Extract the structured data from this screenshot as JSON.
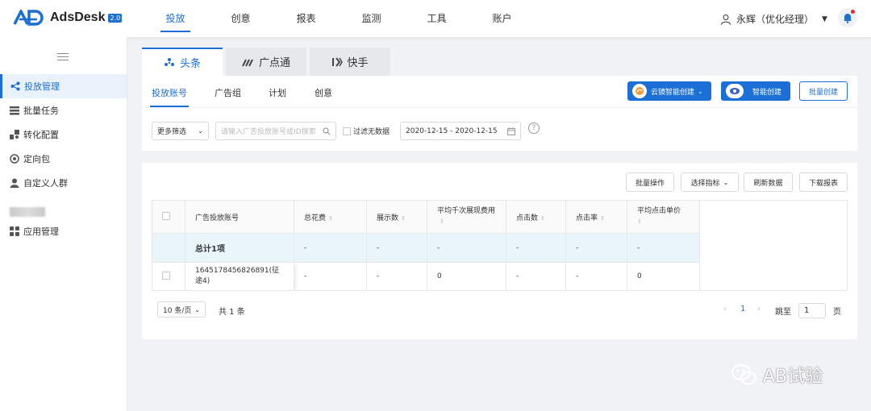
{
  "app": {
    "name": "AdsDesk",
    "version": "2.0"
  },
  "topnav": {
    "items": [
      {
        "label": "投放",
        "active": true
      },
      {
        "label": "创意"
      },
      {
        "label": "报表"
      },
      {
        "label": "监测"
      },
      {
        "label": "工具"
      },
      {
        "label": "账户"
      }
    ]
  },
  "user": {
    "name": "永辉（优化经理）"
  },
  "sidebar": {
    "items": [
      {
        "label": "投放管理",
        "icon": "share-icon",
        "active": true
      },
      {
        "label": "批量任务",
        "icon": "list-icon"
      },
      {
        "label": "转化配置",
        "icon": "convert-icon"
      },
      {
        "label": "定向包",
        "icon": "target-icon"
      },
      {
        "label": "自定义人群",
        "icon": "person-icon"
      },
      {
        "label": "应用管理",
        "icon": "apps-icon"
      }
    ]
  },
  "platform_tabs": [
    {
      "label": "头条",
      "icon": "toutiao-icon",
      "active": true
    },
    {
      "label": "广点通",
      "icon": "gdt-icon"
    },
    {
      "label": "快手",
      "icon": "kuaishou-icon"
    }
  ],
  "subtabs": [
    {
      "label": "投放账号",
      "active": true
    },
    {
      "label": "广告组"
    },
    {
      "label": "计划"
    },
    {
      "label": "创意"
    }
  ],
  "actions": {
    "yunjing": "云镜智能创建",
    "smart": "智能创建",
    "batch_create": "批量创建"
  },
  "filters": {
    "more": "更多筛选",
    "search_placeholder": "请输入广告投放账号或ID搜索",
    "no_data_label": "过滤无数据",
    "date_range": "2020-12-15 - 2020-12-15"
  },
  "toolbar": {
    "batch_ops": "批量操作",
    "choose_metrics": "选择指标",
    "refresh": "刷新数据",
    "download": "下载报表"
  },
  "table": {
    "headers": [
      "广告投放账号",
      "总花费",
      "展示数",
      "平均千次展现费用",
      "点击数",
      "点击率",
      "平均点击单价"
    ],
    "total_row": [
      "总计1项",
      "-",
      "-",
      "-",
      "-",
      "-",
      "-"
    ],
    "rows": [
      [
        "1645178456826891(征途4)",
        "-",
        "-",
        "0",
        "-",
        "-",
        "0"
      ]
    ]
  },
  "pagination": {
    "page_size": "10 条/页",
    "total": "共 1 条",
    "current_page": "1",
    "goto_label": "跳至",
    "goto_value": "1",
    "page_unit": "页"
  },
  "watermark": "AB试验",
  "colors": {
    "primary": "#1b6fd6",
    "total_row_bg": "#e9f4fb"
  }
}
